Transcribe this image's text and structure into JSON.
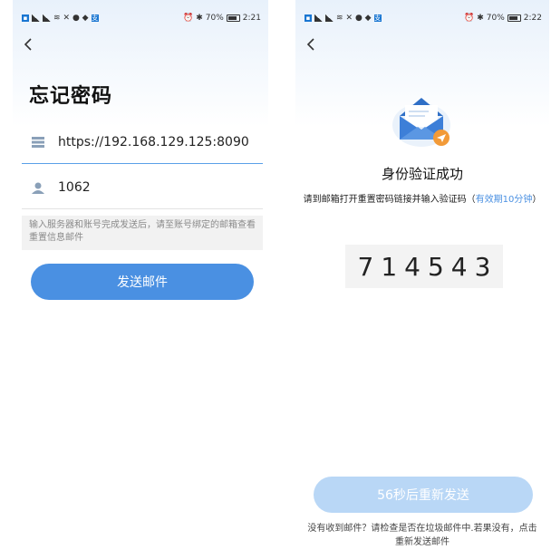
{
  "left_screen": {
    "status": {
      "battery": "70%",
      "time": "2:21"
    },
    "title": "忘记密码",
    "server_url": "https://192.168.129.125:8090",
    "account": "1062",
    "hint": "输入服务器和账号完成发送后，请至账号绑定的邮箱查看重置信息邮件",
    "send_button": "发送邮件"
  },
  "right_screen": {
    "status": {
      "battery": "70%",
      "time": "2:22"
    },
    "title": "身份验证成功",
    "instruction_main": "请到邮箱打开重置密码链接并输入验证码（",
    "instruction_highlight": "有效期10分钟",
    "instruction_end": "）",
    "code": "714543",
    "resend_button": "56秒后重新发送",
    "footer": "没有收到邮件？请检查是否在垃圾邮件中.若果没有，点击重新发送邮件"
  },
  "colors": {
    "accent": "#4a90e2",
    "accent_disabled": "#b9d7f6",
    "hint_bg": "#f2f2f2",
    "envelope_blue": "#3d7fd8",
    "badge_orange": "#f29a38"
  }
}
